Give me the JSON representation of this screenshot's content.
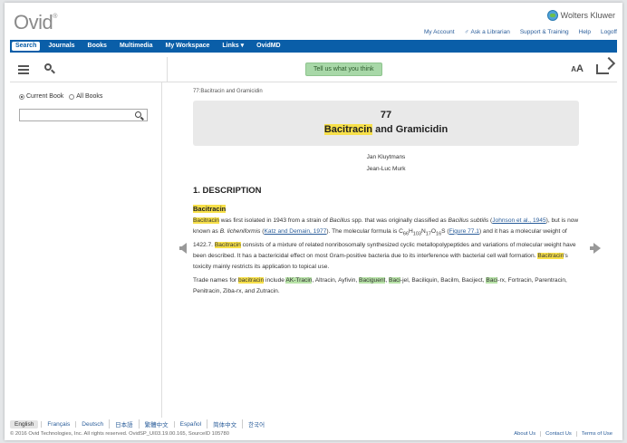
{
  "header": {
    "logo": "Ovid",
    "logo_mark": "®",
    "brand": "Wolters Kluwer",
    "account_links": [
      "My Account",
      "Ask a Librarian",
      "Support & Training",
      "Help",
      "Logoff"
    ]
  },
  "nav": {
    "items": [
      "Search",
      "Journals",
      "Books",
      "Multimedia",
      "My Workspace",
      "Links ▾",
      "OvidMD"
    ]
  },
  "toolbar": {
    "feedback": "Tell us what you think",
    "font_size_label_big": "A",
    "font_size_label_small": "A"
  },
  "sidebar": {
    "radio_current": "Current Book",
    "radio_all": "All Books",
    "search_placeholder": ""
  },
  "content": {
    "breadcrumb": "77:Bacitracin and Gramicidin",
    "chapter_number": "77",
    "chapter_title_hl": "Bacitracin",
    "chapter_title_rest": " and Gramicidin",
    "authors": [
      "Jan Kluytmans",
      "Jean-Luc Murk"
    ],
    "section": "1. DESCRIPTION",
    "subsection": "Bacitracin",
    "p1": {
      "t1": "Bacitracin",
      "t2": " was first isolated in 1943 from a strain of ",
      "t3": "Bacillus",
      "t4": " spp. that was originally classified as ",
      "t5": "Bacillus subtilis",
      "t6": " (",
      "t7": "Johnson et al., 1945",
      "t8": "), but is now known as ",
      "t9": "B. licheniformis",
      "t10": " (",
      "t11": "Katz and Demain, 1977",
      "t12": "). The molecular formula is C",
      "t13": "66",
      "t14": "H",
      "t15": "103",
      "t16": "N",
      "t17": "17",
      "t18": "O",
      "t19": "16",
      "t20": "S (",
      "t21": "Figure 77.1",
      "t22": ") and it has a molecular weight of 1422.7. ",
      "t23": "Bacitracin",
      "t24": " consists of a mixture of related nonribosomally synthesized cyclic metallopolypeptides and variations of molecular weight have been described. It has a bactericidal effect on most Gram-positive bacteria due to its interference with bacterial cell wall formation. ",
      "t25": "Bacitracin",
      "t26": "'s toxicity mainly restricts its application to topical use."
    },
    "p2": {
      "t1": "Trade names for ",
      "t2": "bacitracin",
      "t3": " include ",
      "t4": "AK-Tracin",
      "t5": ", Altracin, Ayfivin, ",
      "t6": "Baciguent",
      "t7": ", ",
      "t8": "Baci",
      "t9": "-jel, Baciliquin, Bacilm, Baciject, ",
      "t10": "Baci",
      "t11": "-rx, Fortracin, Parentracin, Penitracin, Ziba-rx, and Zutracin."
    }
  },
  "footer": {
    "languages": [
      "English",
      "Français",
      "Deutsch",
      "日本語",
      "繁體中文",
      "Español",
      "简体中文",
      "한국어"
    ],
    "copyright": "© 2016 Ovid Technologies, Inc. All rights reserved.   OvidSP_UI03.19.00.165, SourceID 105780",
    "links": [
      "About Us",
      "Contact Us",
      "Terms of Use"
    ]
  },
  "colors": {
    "nav_bg": "#0a5ea8",
    "highlight": "#f7e04a",
    "highlight_green": "#b8e3a8"
  },
  "icons": [
    "list-icon",
    "search-icon",
    "share-icon",
    "globe-icon",
    "prev-page-icon",
    "next-page-icon"
  ]
}
